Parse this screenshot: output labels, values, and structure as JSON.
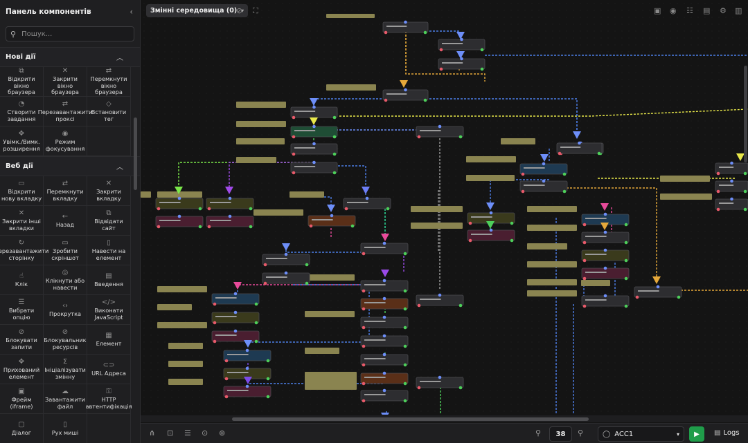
{
  "sidebar": {
    "title": "Панель компонентів",
    "search_placeholder": "Пошук...",
    "sections": [
      {
        "title": "Нові дії",
        "items": [
          {
            "label": "Відкрити вікно браузера",
            "icon": "external-link-icon"
          },
          {
            "label": "Закрити вікно браузера",
            "icon": "close-icon"
          },
          {
            "label": "Перемкнути вікно браузера",
            "icon": "switch-icon"
          },
          {
            "label": "Створити завдання",
            "icon": "task-icon"
          },
          {
            "label": "Перезавантажити проксі",
            "icon": "reload-icon"
          },
          {
            "label": "Встановити тег",
            "icon": "tag-icon"
          },
          {
            "label": "Увімк./Вимк. розширення",
            "icon": "puzzle-icon"
          },
          {
            "label": "Режим фокусування",
            "icon": "eye-icon"
          }
        ]
      },
      {
        "title": "Веб дії",
        "items": [
          {
            "label": "Відкрити нову вкладку",
            "icon": "new-tab-icon"
          },
          {
            "label": "Перемкнути вкладку",
            "icon": "switch-icon"
          },
          {
            "label": "Закрити вкладку",
            "icon": "close-icon"
          },
          {
            "label": "Закрити інші вкладки",
            "icon": "close-icon"
          },
          {
            "label": "Назад",
            "icon": "arrow-left-icon"
          },
          {
            "label": "Відвідати сайт",
            "icon": "external-link-icon"
          },
          {
            "label": "Перезавантажити сторінку",
            "icon": "reload-icon"
          },
          {
            "label": "Зробити скріншот",
            "icon": "monitor-icon"
          },
          {
            "label": "Навести на елемент",
            "icon": "mouse-icon"
          },
          {
            "label": "Клік",
            "icon": "pointer-icon"
          },
          {
            "label": "Клікнути або навести",
            "icon": "target-icon"
          },
          {
            "label": "Введення",
            "icon": "keyboard-icon"
          },
          {
            "label": "Вибрати опцію",
            "icon": "list-icon"
          },
          {
            "label": "Прокрутка",
            "icon": "scroll-icon"
          },
          {
            "label": "Виконати JavaScript",
            "icon": "code-icon"
          },
          {
            "label": "Блокувати запити",
            "icon": "block-icon"
          },
          {
            "label": "Блокувальник ресурсів",
            "icon": "block-icon"
          },
          {
            "label": "Елемент",
            "icon": "element-icon"
          },
          {
            "label": "Прихований елемент",
            "icon": "puzzle-icon"
          },
          {
            "label": "Ініціалізувати змінну",
            "icon": "sigma-icon"
          },
          {
            "label": "URL Адреса",
            "icon": "link-icon"
          },
          {
            "label": "Фрейм (iframe)",
            "icon": "frame-icon"
          },
          {
            "label": "Завантажити файл",
            "icon": "download-icon"
          },
          {
            "label": "HTTP автентифікація",
            "icon": "lock-icon"
          },
          {
            "label": "Діалог",
            "icon": "dialog-icon"
          },
          {
            "label": "Рух миші",
            "icon": "mouse-icon"
          }
        ]
      }
    ]
  },
  "topbar": {
    "env_label": "Змінні середовища (0)"
  },
  "bottombar": {
    "zoom": "38",
    "profile": "ACC1",
    "logs_label": "Logs"
  },
  "colors": {
    "accent_green": "#1f9d4a",
    "node_bg": "#2d2d30",
    "sticky": "#8a8450"
  }
}
